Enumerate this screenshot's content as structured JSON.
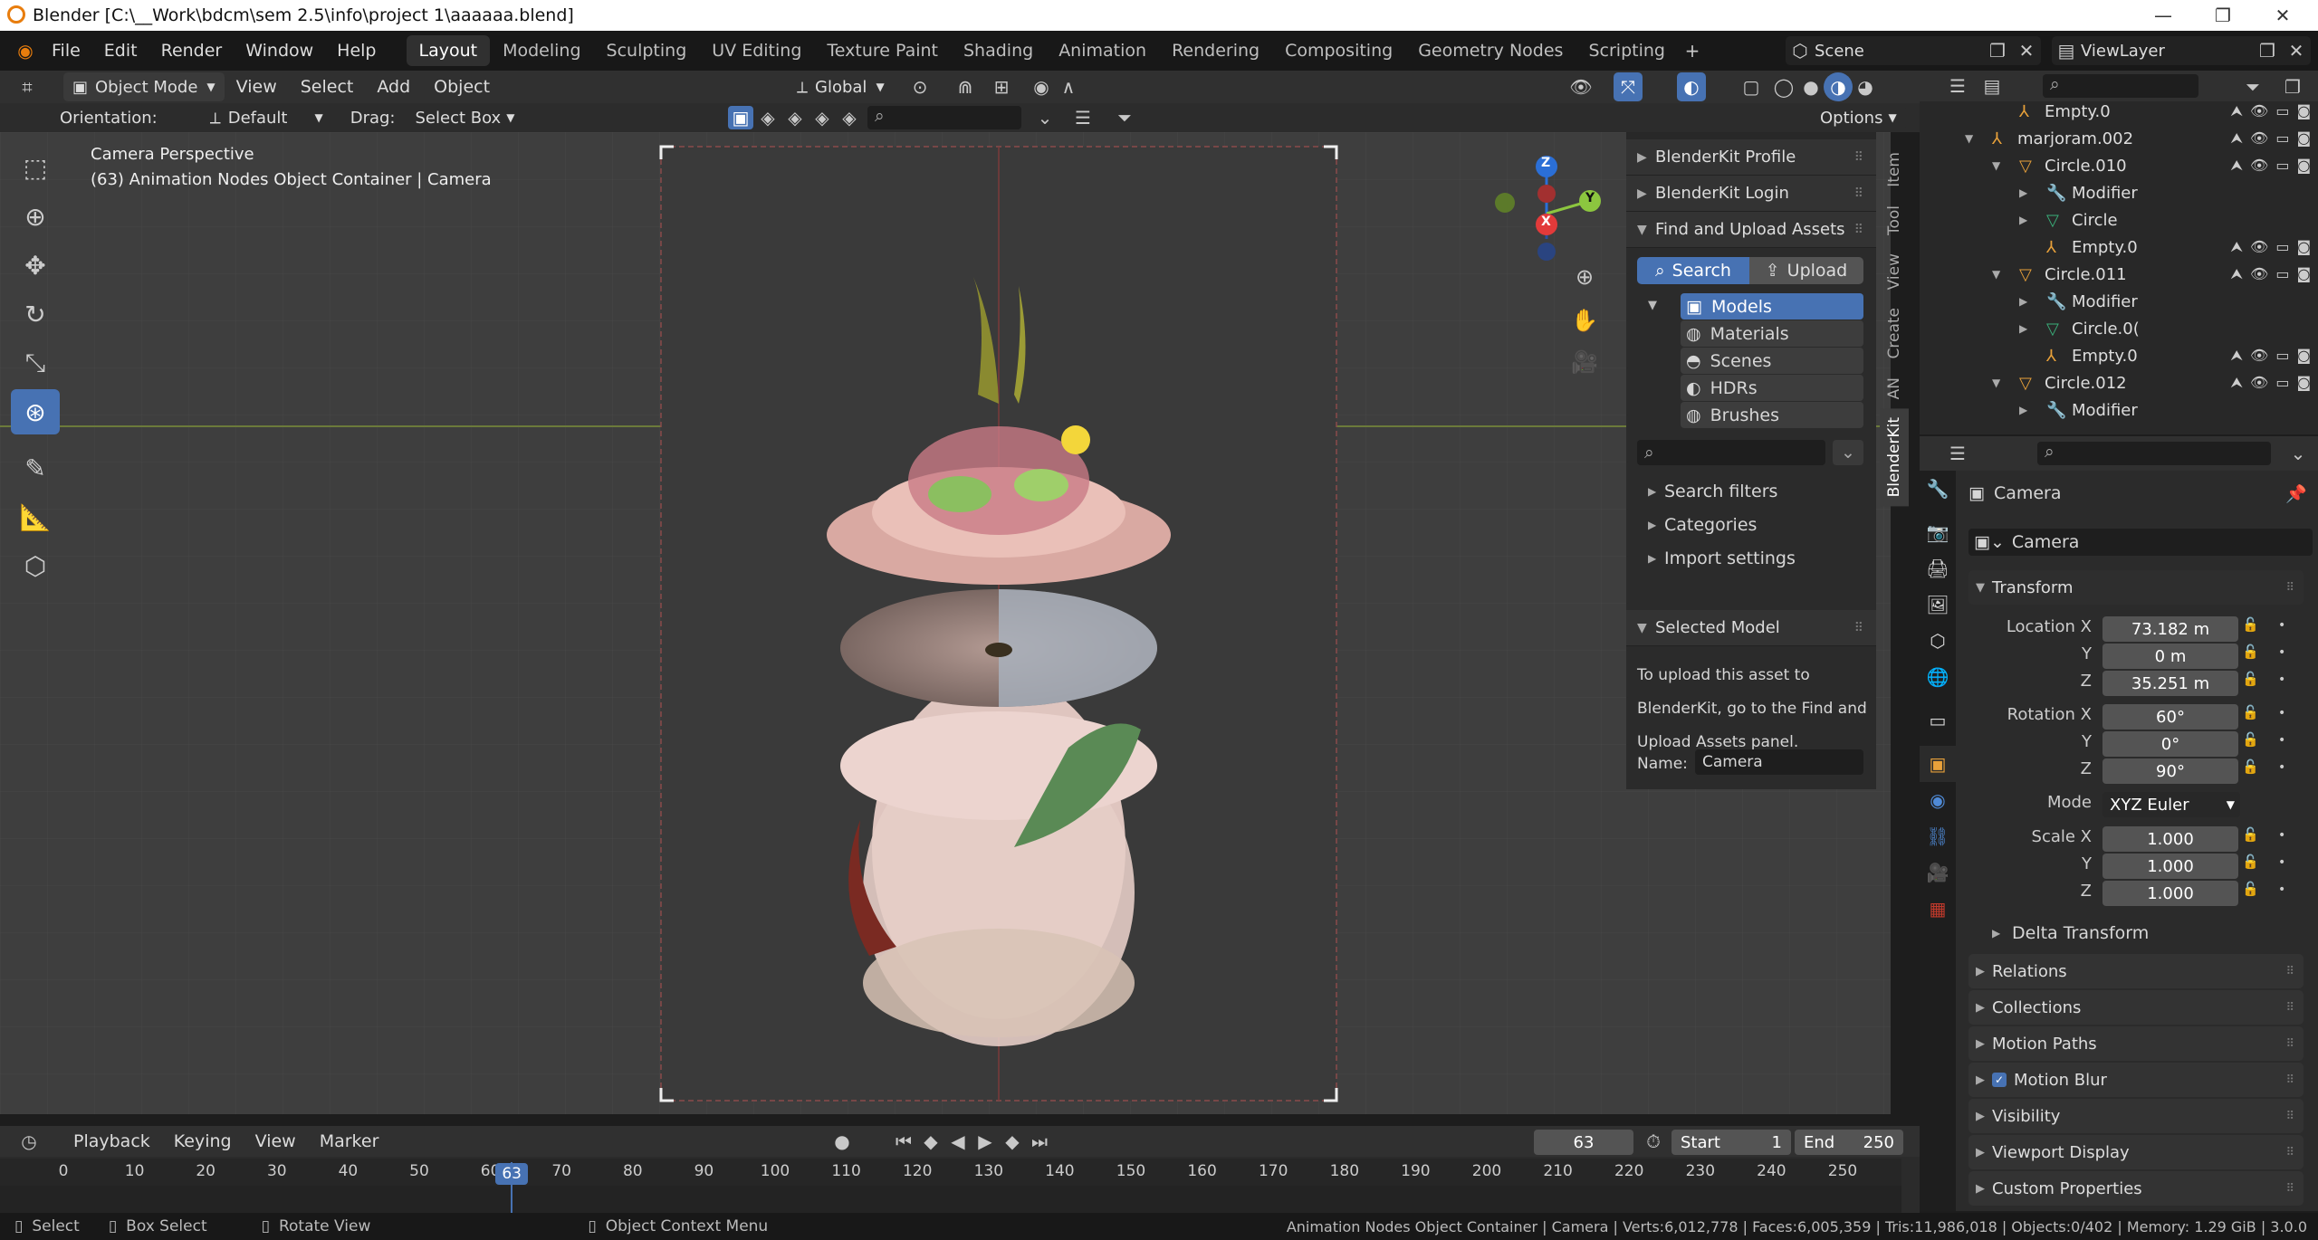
{
  "window": {
    "title": "Blender [C:\\__Work\\bdcm\\sem 2.5\\info\\project 1\\aaaaaa.blend]",
    "controls": [
      "minimize-icon",
      "maximize-icon",
      "close-icon"
    ]
  },
  "menubar": {
    "items": [
      "File",
      "Edit",
      "Render",
      "Window",
      "Help"
    ],
    "workspaces": [
      "Layout",
      "Modeling",
      "Sculpting",
      "UV Editing",
      "Texture Paint",
      "Shading",
      "Animation",
      "Rendering",
      "Compositing",
      "Geometry Nodes",
      "Scripting"
    ],
    "active_workspace": "Layout",
    "scene": "Scene",
    "view_layer": "ViewLayer"
  },
  "viewport_header": {
    "mode": "Object Mode",
    "menus": [
      "View",
      "Select",
      "Add",
      "Object"
    ],
    "transform_orientation": "Global",
    "orientation_label": "Orientation:",
    "orientation_value": "Default",
    "drag_label": "Drag:",
    "drag_value": "Select Box",
    "options": "Options"
  },
  "viewport": {
    "line1": "Camera Perspective",
    "line2": "(63) Animation Nodes Object Container | Camera",
    "gizmo": {
      "z": "Z",
      "y": "Y",
      "x": "X"
    }
  },
  "npanel": {
    "sections": {
      "profile": "BlenderKit Profile",
      "login": "BlenderKit Login",
      "find": "Find and Upload Assets",
      "search_filters": "Search filters",
      "categories": "Categories",
      "import_settings": "Import settings",
      "selected_model": "Selected Model"
    },
    "search_btn": "Search",
    "upload_btn": "Upload",
    "asset_types": [
      "Models",
      "Materials",
      "Scenes",
      "HDRs",
      "Brushes"
    ],
    "active_asset_type": "Models",
    "upload_text": [
      "To upload this asset to",
      "BlenderKit, go to the Find and",
      "Upload Assets panel."
    ],
    "name_label": "Name:",
    "name_value": "Camera",
    "tabs": [
      "Item",
      "Tool",
      "View",
      "Create",
      "AN",
      "BlenderKit"
    ],
    "active_tab": "BlenderKit"
  },
  "outliner": {
    "rows": [
      {
        "label": "Empty.0",
        "icon": "empty-icon",
        "indent": 3,
        "vis": true
      },
      {
        "label": "marjoram.002",
        "icon": "empty-icon",
        "indent": 2,
        "vis": true,
        "expanded": true
      },
      {
        "label": "Circle.010",
        "icon": "mesh-object-icon",
        "indent": 3,
        "vis": true,
        "expanded": true
      },
      {
        "label": "Modifier",
        "icon": "wrench-icon",
        "indent": 4,
        "vis": false
      },
      {
        "label": "Circle",
        "icon": "mesh-data-icon",
        "indent": 4,
        "vis": false
      },
      {
        "label": "Empty.0",
        "icon": "empty-icon",
        "indent": 4,
        "vis": true
      },
      {
        "label": "Circle.011",
        "icon": "mesh-object-icon",
        "indent": 3,
        "vis": true,
        "expanded": true
      },
      {
        "label": "Modifier",
        "icon": "wrench-icon",
        "indent": 4,
        "vis": false
      },
      {
        "label": "Circle.0(",
        "icon": "mesh-data-icon",
        "indent": 4,
        "vis": false
      },
      {
        "label": "Empty.0",
        "icon": "empty-icon",
        "indent": 4,
        "vis": true
      },
      {
        "label": "Circle.012",
        "icon": "mesh-object-icon",
        "indent": 3,
        "vis": true,
        "expanded": true
      },
      {
        "label": "Modifier",
        "icon": "wrench-icon",
        "indent": 4,
        "vis": false
      }
    ]
  },
  "properties": {
    "object_name": "Camera",
    "object_datablock": "Camera",
    "transform_title": "Transform",
    "location_label": "Location X",
    "location": [
      "73.182 m",
      "0 m",
      "35.251 m"
    ],
    "rotation_label": "Rotation X",
    "rotation": [
      "60°",
      "0°",
      "90°"
    ],
    "axis_y": "Y",
    "axis_z": "Z",
    "mode_label": "Mode",
    "mode_value": "XYZ Euler",
    "scale_label": "Scale X",
    "scale": [
      "1.000",
      "1.000",
      "1.000"
    ],
    "delta_transform": "Delta Transform",
    "sections": [
      "Relations",
      "Collections",
      "Motion Paths",
      "Motion Blur",
      "Visibility",
      "Viewport Display",
      "Custom Properties"
    ]
  },
  "timeline": {
    "menus": [
      "Playback",
      "Keying",
      "View",
      "Marker"
    ],
    "current_frame": "63",
    "start_label": "Start",
    "start_value": "1",
    "end_label": "End",
    "end_value": "250",
    "ticks": [
      "0",
      "10",
      "20",
      "30",
      "40",
      "50",
      "60",
      "70",
      "80",
      "90",
      "100",
      "110",
      "120",
      "130",
      "140",
      "150",
      "160",
      "170",
      "180",
      "190",
      "200",
      "210",
      "220",
      "230",
      "240",
      "250"
    ]
  },
  "statusbar": {
    "select": "Select",
    "box_select": "Box Select",
    "rotate": "Rotate View",
    "context": "Object Context Menu",
    "stats": "Animation Nodes Object Container | Camera | Verts:6,012,778 | Faces:6,005,359 | Tris:11,986,018 | Objects:0/402 | Memory: 1.29 GiB | 3.0.0"
  },
  "colors": {
    "accent": "#4772b3",
    "viewport_bg": "#3e3e3e",
    "header": "#303030",
    "panel": "#282828"
  }
}
